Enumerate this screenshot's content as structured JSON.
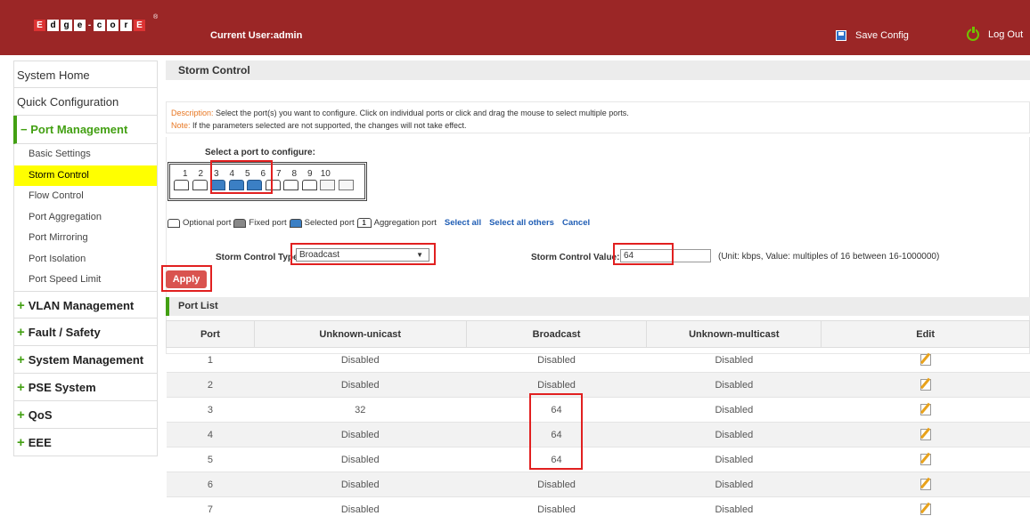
{
  "header": {
    "logo_letters": [
      "E",
      "d",
      "g",
      "e",
      "-",
      "c",
      "o",
      "r",
      "E"
    ],
    "reg_mark": "®",
    "current_user": "Current User:admin",
    "save_config": "Save Config",
    "logout": "Log Out"
  },
  "sidebar": {
    "system_home": "System Home",
    "quick_config": "Quick Configuration",
    "port_management": "Port Management",
    "port_management_prefix": "−",
    "sub_items": [
      "Basic Settings",
      "Storm Control",
      "Flow Control",
      "Port Aggregation",
      "Port Mirroring",
      "Port Isolation",
      "Port Speed Limit"
    ],
    "active_sub": "Storm Control",
    "groups": [
      "VLAN Management",
      "Fault / Safety",
      "System Management",
      "PSE System",
      "QoS",
      "EEE"
    ],
    "group_prefix": "+"
  },
  "main": {
    "title": "Storm Control",
    "description_label": "Description:",
    "description_text": "Select the port(s) you want to configure. Click on individual ports or click and drag the mouse to select multiple ports.",
    "note_label": "Note:",
    "note_text": "If the parameters selected are not supported, the changes will not take effect.",
    "select_port_label": "Select a port to configure:",
    "port_numbers": [
      "1",
      "2",
      "3",
      "4",
      "5",
      "6",
      "7",
      "8",
      "9",
      "10"
    ],
    "selected_ports": [
      3,
      4,
      5
    ],
    "legend": {
      "optional": "Optional port",
      "fixed": "Fixed port",
      "selected": "Selected port",
      "aggregation_num": "1",
      "aggregation": "Aggregation port",
      "select_all": "Select all",
      "select_all_others": "Select all others",
      "cancel": "Cancel"
    },
    "storm_control_type_label": "Storm Control Type",
    "storm_control_type_value": "Broadcast",
    "storm_control_value_label": "Storm Control Value:",
    "storm_control_value": "64",
    "storm_control_hint": "(Unit: kbps, Value: multiples of 16 between 16-1000000)",
    "apply_label": "Apply"
  },
  "port_list": {
    "title": "Port List",
    "columns": [
      "Port",
      "Unknown-unicast",
      "Broadcast",
      "Unknown-multicast",
      "Edit"
    ],
    "rows": [
      [
        "1",
        "Disabled",
        "Disabled",
        "Disabled"
      ],
      [
        "2",
        "Disabled",
        "Disabled",
        "Disabled"
      ],
      [
        "3",
        "32",
        "64",
        "Disabled"
      ],
      [
        "4",
        "Disabled",
        "64",
        "Disabled"
      ],
      [
        "5",
        "Disabled",
        "64",
        "Disabled"
      ],
      [
        "6",
        "Disabled",
        "Disabled",
        "Disabled"
      ],
      [
        "7",
        "Disabled",
        "Disabled",
        "Disabled"
      ]
    ]
  },
  "colors": {
    "header_bg": "#9b2626",
    "accent_green": "#43a013",
    "apply_red": "#d9534f",
    "highlight_red": "#e12020",
    "active_yellow": "#ffff00",
    "link_blue": "#1f5db4"
  }
}
